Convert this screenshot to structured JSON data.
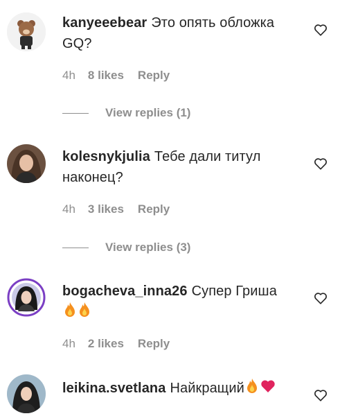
{
  "comments": [
    {
      "username": "kanyeeebear",
      "text": "Это опять обложка GQ?",
      "time": "4h",
      "likes": "8 likes",
      "reply_label": "Reply",
      "view_replies": "View replies (1)",
      "avatar_icon": "bear-avatar-icon"
    },
    {
      "username": "kolesnykjulia",
      "text": "Тебе дали титул наконец?",
      "time": "4h",
      "likes": "3 likes",
      "reply_label": "Reply",
      "view_replies": "View replies (3)",
      "avatar_icon": "woman-avatar-icon"
    },
    {
      "username": "bogacheva_inna26",
      "text": "Супер Гриша",
      "emojis": [
        "fire-emoji",
        "fire-emoji"
      ],
      "time": "4h",
      "likes": "2 likes",
      "reply_label": "Reply",
      "avatar_icon": "woman-story-avatar-icon"
    },
    {
      "username": "leikina.svetlana",
      "text": "Найкращий",
      "emojis": [
        "fire-emoji",
        "red-heart-emoji"
      ],
      "avatar_icon": "woman-avatar-icon"
    }
  ],
  "colors": {
    "text": "#262626",
    "secondary": "#8e8e8e",
    "fire": "#f5901e",
    "heart": "#e0245e"
  }
}
